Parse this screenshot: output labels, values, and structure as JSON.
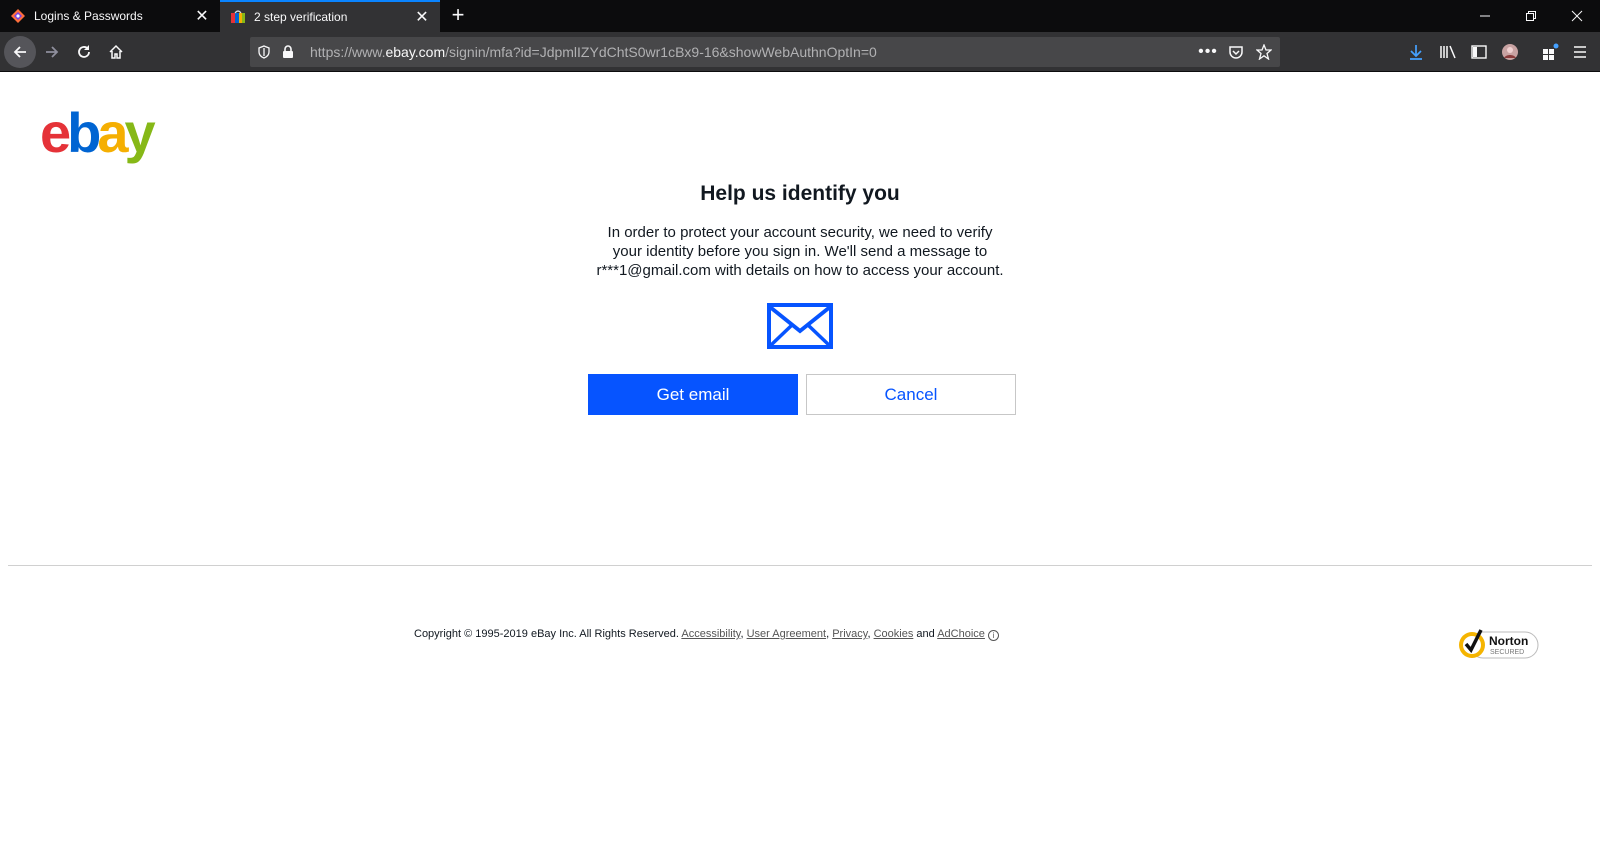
{
  "browser": {
    "tabs": [
      {
        "title": "Logins & Passwords",
        "icon": "lockwise-icon",
        "active": false
      },
      {
        "title": "2 step verification",
        "icon": "ebay-favicon-icon",
        "active": true
      }
    ],
    "url": {
      "prefix": "https://www.",
      "host": "ebay.com",
      "path": "/signin/mfa?id=JdpmlIZYdChtS0wr1cBx9-16&showWebAuthnOptIn=0"
    }
  },
  "logo": {
    "e": "e",
    "b": "b",
    "a": "a",
    "y": "y"
  },
  "main": {
    "heading": "Help us identify you",
    "desc_line1": "In order to protect your account security, we need to verify",
    "desc_line2": "your identity before you sign in. We'll send a message to",
    "desc_line3": "r***1@gmail.com with details on how to access your account.",
    "primary_button": "Get email",
    "secondary_button": "Cancel"
  },
  "footer": {
    "copyright": "Copyright © 1995-2019 eBay Inc. All Rights Reserved.",
    "links": [
      "Accessibility",
      "User Agreement",
      "Privacy",
      "Cookies"
    ],
    "and": "and",
    "adchoice": "AdChoice"
  },
  "norton": {
    "line1": "Norton",
    "line2": "SECURED"
  },
  "colors": {
    "brand_blue": "#0654ff",
    "tab_accent": "#0a84ff"
  }
}
